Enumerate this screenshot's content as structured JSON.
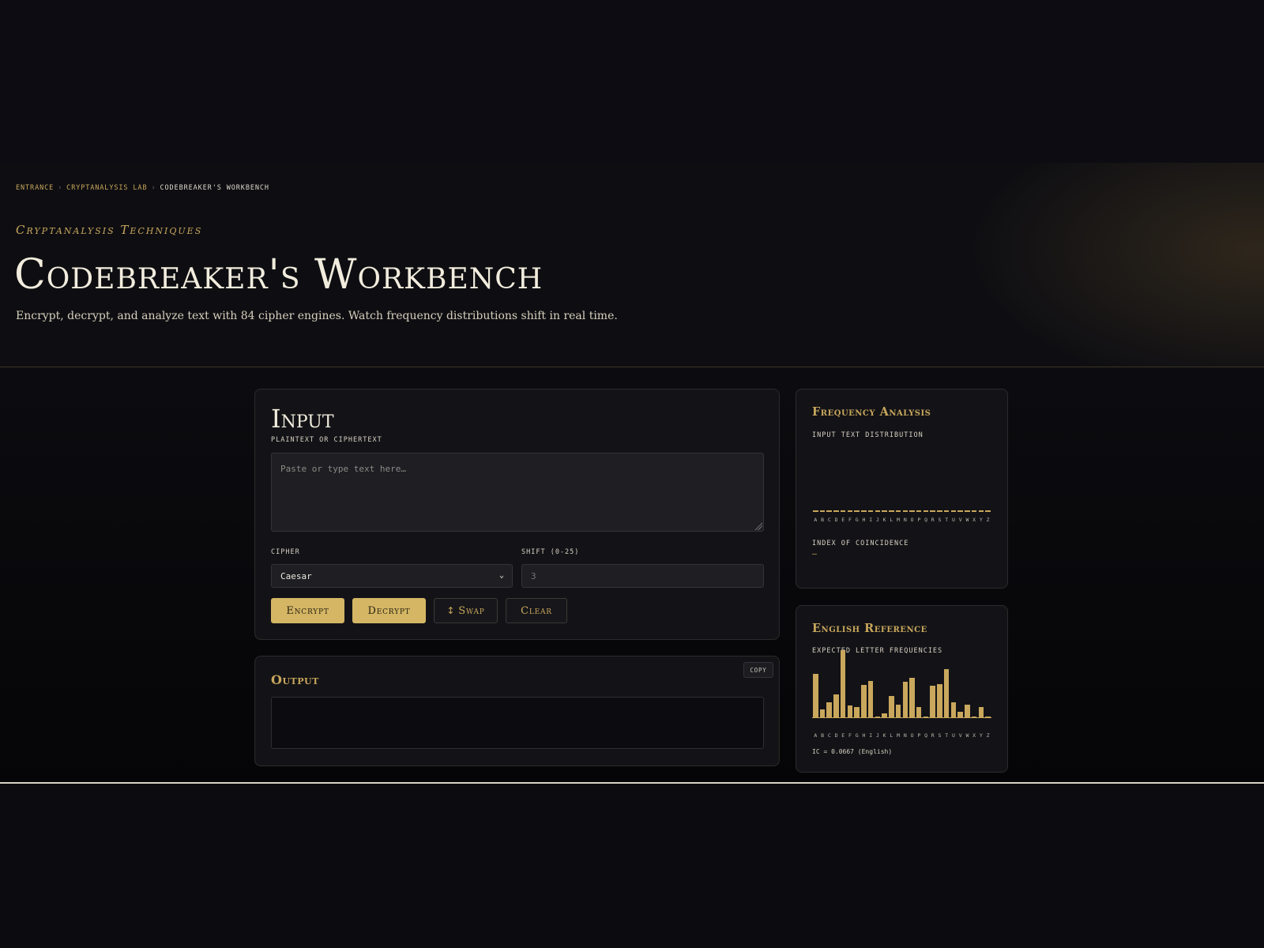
{
  "breadcrumb": {
    "items": [
      "Entrance",
      "Cryptanalysis Lab"
    ],
    "current": "Codebreaker's Workbench",
    "separator": "›"
  },
  "hero": {
    "eyebrow": "Cryptanalysis Techniques",
    "title": "Codebreaker's Workbench",
    "subtitle": "Encrypt, decrypt, and analyze text with 84 cipher engines. Watch frequency distributions shift in real time."
  },
  "input_panel": {
    "heading": "Input",
    "text_label": "PLAINTEXT OR CIPHERTEXT",
    "text_placeholder": "Paste or type text here…",
    "text_value": "",
    "cipher_label": "CIPHER",
    "cipher_selected": "Caesar",
    "shift_label": "SHIFT (0-25)",
    "shift_placeholder": "3",
    "buttons": {
      "encrypt": "Encrypt",
      "decrypt": "Decrypt",
      "swap": "Swap",
      "clear": "Clear"
    }
  },
  "output_panel": {
    "heading": "Output",
    "copy_label": "COPY",
    "value": ""
  },
  "frequency_panel": {
    "heading": "Frequency Analysis",
    "subheading": "INPUT TEXT DISTRIBUTION",
    "ic_label": "INDEX OF COINCIDENCE",
    "ic_value": "—"
  },
  "reference_panel": {
    "heading": "English Reference",
    "subheading": "EXPECTED LETTER FREQUENCIES",
    "ic_note": "IC = 0.0667 (English)"
  },
  "alphabet": [
    "A",
    "B",
    "C",
    "D",
    "E",
    "F",
    "G",
    "H",
    "I",
    "J",
    "K",
    "L",
    "M",
    "N",
    "O",
    "P",
    "Q",
    "R",
    "S",
    "T",
    "U",
    "V",
    "W",
    "X",
    "Y",
    "Z"
  ],
  "colors": {
    "gold": "#c9a75c",
    "gold_button": "#d4b665",
    "background": "#0b0b10",
    "card": "#131317"
  },
  "chart_data": [
    {
      "type": "bar",
      "title": "Input Text Distribution",
      "categories": [
        "A",
        "B",
        "C",
        "D",
        "E",
        "F",
        "G",
        "H",
        "I",
        "J",
        "K",
        "L",
        "M",
        "N",
        "O",
        "P",
        "Q",
        "R",
        "S",
        "T",
        "U",
        "V",
        "W",
        "X",
        "Y",
        "Z"
      ],
      "values": [
        0,
        0,
        0,
        0,
        0,
        0,
        0,
        0,
        0,
        0,
        0,
        0,
        0,
        0,
        0,
        0,
        0,
        0,
        0,
        0,
        0,
        0,
        0,
        0,
        0,
        0
      ]
    },
    {
      "type": "bar",
      "title": "Expected Letter Frequencies",
      "categories": [
        "A",
        "B",
        "C",
        "D",
        "E",
        "F",
        "G",
        "H",
        "I",
        "J",
        "K",
        "L",
        "M",
        "N",
        "O",
        "P",
        "Q",
        "R",
        "S",
        "T",
        "U",
        "V",
        "W",
        "X",
        "Y",
        "Z"
      ],
      "values": [
        8.2,
        1.5,
        2.8,
        4.3,
        12.7,
        2.2,
        2.0,
        6.1,
        6.9,
        0.15,
        0.77,
        4.0,
        2.4,
        6.7,
        7.5,
        1.9,
        0.1,
        6.0,
        6.3,
        9.1,
        2.8,
        0.98,
        2.4,
        0.15,
        2.0,
        0.07
      ],
      "ylim": [
        0,
        12.7
      ]
    }
  ]
}
